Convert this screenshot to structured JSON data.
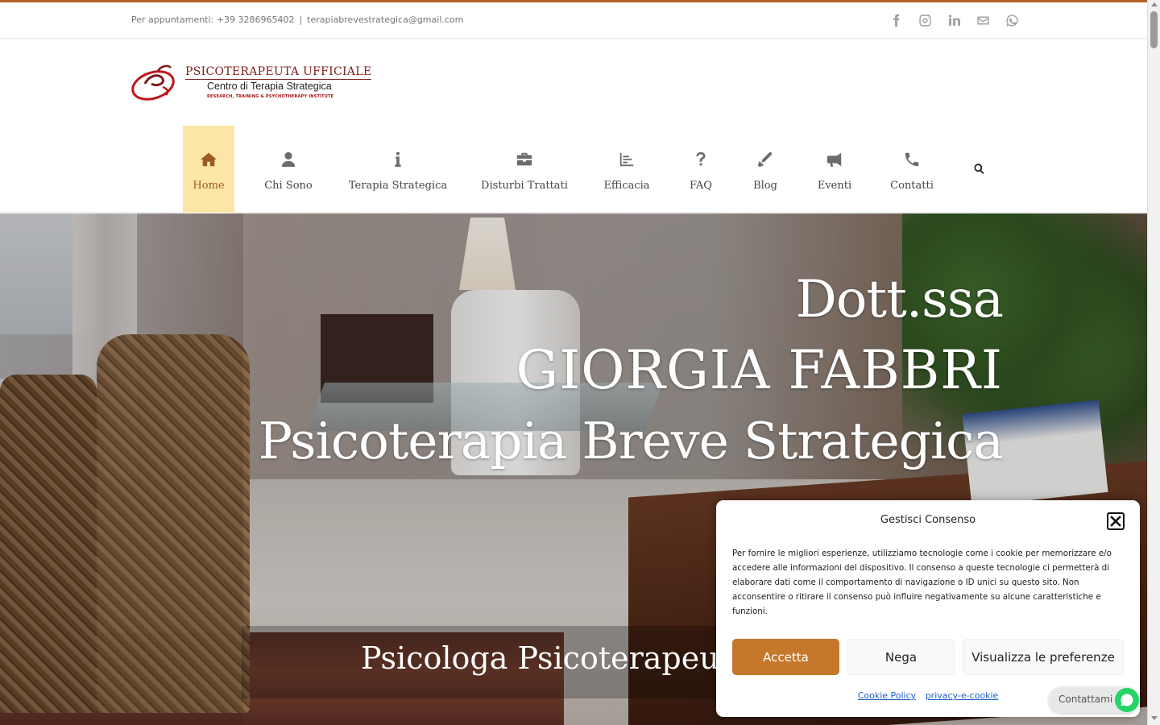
{
  "topbar": {
    "phone_text": "Per appuntamenti: +39 3286965402",
    "separator": "|",
    "email": "terapiabrevestrategica@gmail.com",
    "social": [
      "facebook-icon",
      "instagram-icon",
      "linkedin-icon",
      "mail-icon",
      "whatsapp-icon"
    ]
  },
  "logo": {
    "line1": "PSICOTERAPEUTA UFFICIALE",
    "line2": "Centro di Terapia Strategica",
    "line3": "RESEARCH, TRAINING & PSYCHOTHERAPY INSTITUTE"
  },
  "nav": {
    "items": [
      {
        "label": "Home",
        "icon": "home-icon"
      },
      {
        "label": "Chi Sono",
        "icon": "user-icon"
      },
      {
        "label": "Terapia Strategica",
        "icon": "info-icon"
      },
      {
        "label": "Disturbi Trattati",
        "icon": "briefcase-icon"
      },
      {
        "label": "Efficacia",
        "icon": "bar-chart-icon"
      },
      {
        "label": "FAQ",
        "icon": "question-icon"
      },
      {
        "label": "Blog",
        "icon": "pen-icon"
      },
      {
        "label": "Eventi",
        "icon": "megaphone-icon"
      },
      {
        "label": "Contatti",
        "icon": "phone-icon"
      }
    ],
    "active": "Home"
  },
  "hero": {
    "line1": "Dott.ssa",
    "line2": "GIORGIA FABBRI",
    "line3": "Psicoterapia Breve Strategica",
    "subtitle": "Psicologa Psicoterapeuta"
  },
  "consent": {
    "title": "Gestisci Consenso",
    "text": "Per fornire le migliori esperienze, utilizziamo tecnologie come i cookie per memorizzare e/o accedere alle informazioni del dispositivo. Il consenso a queste tecnologie ci permetterà di elaborare dati come il comportamento di navigazione o ID unici su questo sito. Non acconsentire o ritirare il consenso può influire negativamente su alcune caratteristiche e funzioni.",
    "accept_label": "Accetta",
    "deny_label": "Nega",
    "prefs_label": "Visualizza le preferenze",
    "link1": "Cookie Policy",
    "link2": "privacy-e-cookie"
  },
  "whatsapp": {
    "label": "Contattami"
  },
  "colors": {
    "accent": "#c5782b",
    "nav_active_bg": "#fbe6a7",
    "nav_active_text": "#9a5b22",
    "top_border": "#b5602b",
    "whatsapp": "#25d366"
  }
}
